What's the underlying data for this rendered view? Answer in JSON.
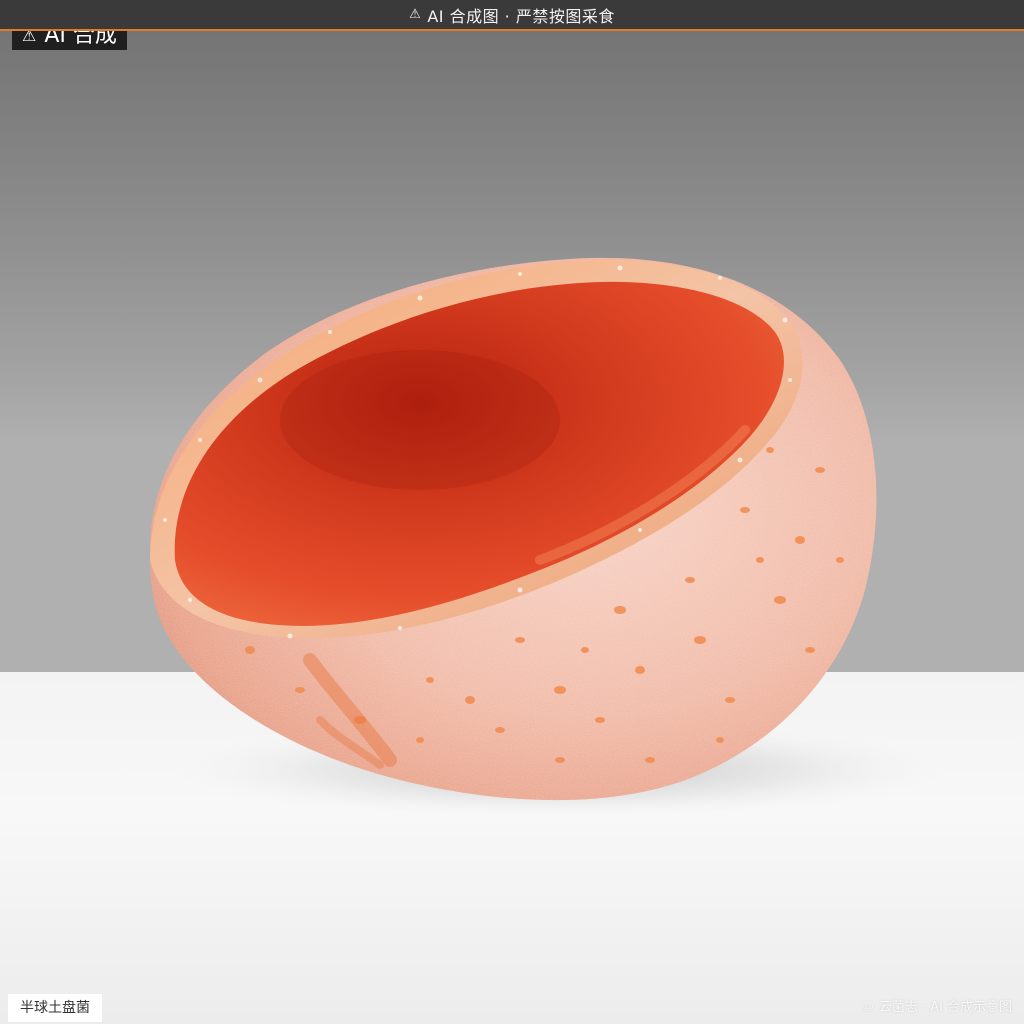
{
  "banner": {
    "icon": "warning-icon",
    "text": "AI 合成图 · 严禁按图采食"
  },
  "badge": {
    "icon": "warning-icon",
    "text": "AI 合成"
  },
  "species_label": "半球土盘菌",
  "watermark": "© 云菌志 · AI 合成示意图",
  "colors": {
    "cup_interior": "#e04a28",
    "cup_exterior": "#f2b7a2",
    "warts": "#f08a4e",
    "banner_accent": "#e07b2a"
  }
}
